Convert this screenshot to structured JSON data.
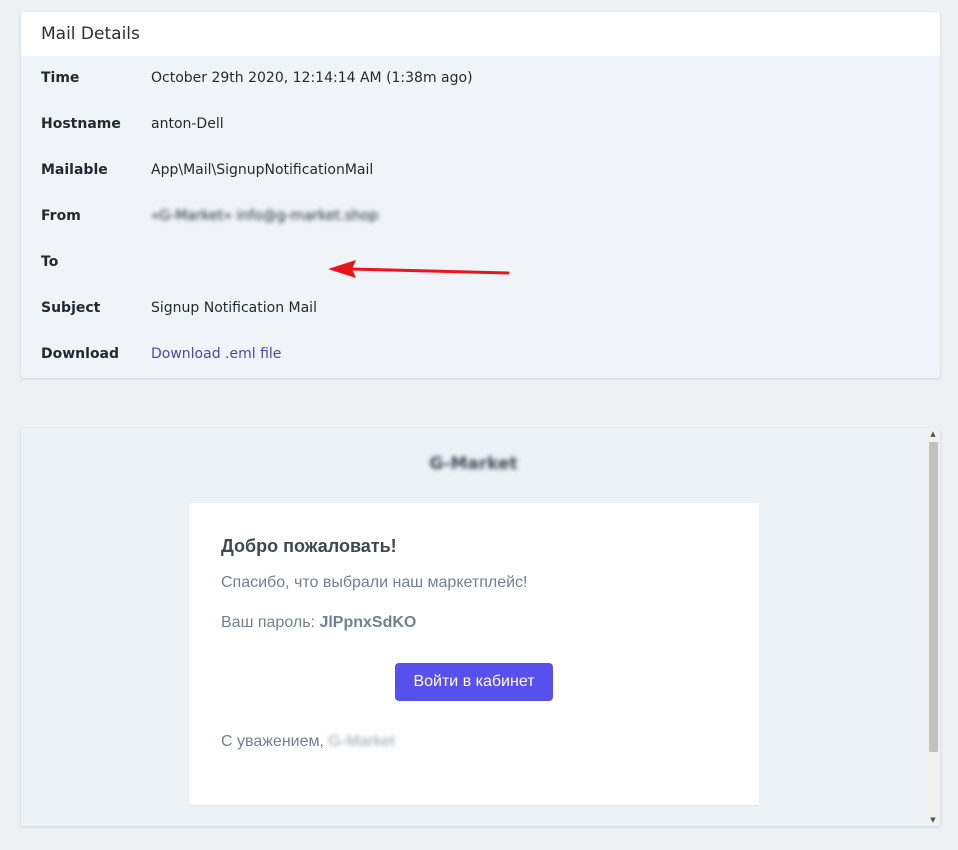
{
  "details": {
    "title": "Mail Details",
    "rows": [
      {
        "label": "Time",
        "value": "October 29th 2020, 12:14:14 AM (1:38m ago)"
      },
      {
        "label": "Hostname",
        "value": "anton-Dell"
      },
      {
        "label": "Mailable",
        "value": "App\\Mail\\SignupNotificationMail"
      },
      {
        "label": "From",
        "value": "«G-Market» info@g-market.shop"
      },
      {
        "label": "To",
        "value": ""
      },
      {
        "label": "Subject",
        "value": "Signup Notification Mail"
      },
      {
        "label": "Download",
        "value": "Download .eml file"
      }
    ]
  },
  "annotation": {
    "arrow_color": "#e8151b"
  },
  "preview": {
    "brand": "G-Market",
    "heading": "Добро пожаловать!",
    "thanks": "Спасибо, что выбрали наш маркетплейс!",
    "password_label": "Ваш пароль:",
    "password_value": "JlPpnxSdKO",
    "button_label": "Войти в кабинет",
    "signoff_prefix": "С уважением,",
    "signoff_name": "G-Market"
  },
  "colors": {
    "accent": "#5850ec",
    "link": "#4f46a8"
  }
}
